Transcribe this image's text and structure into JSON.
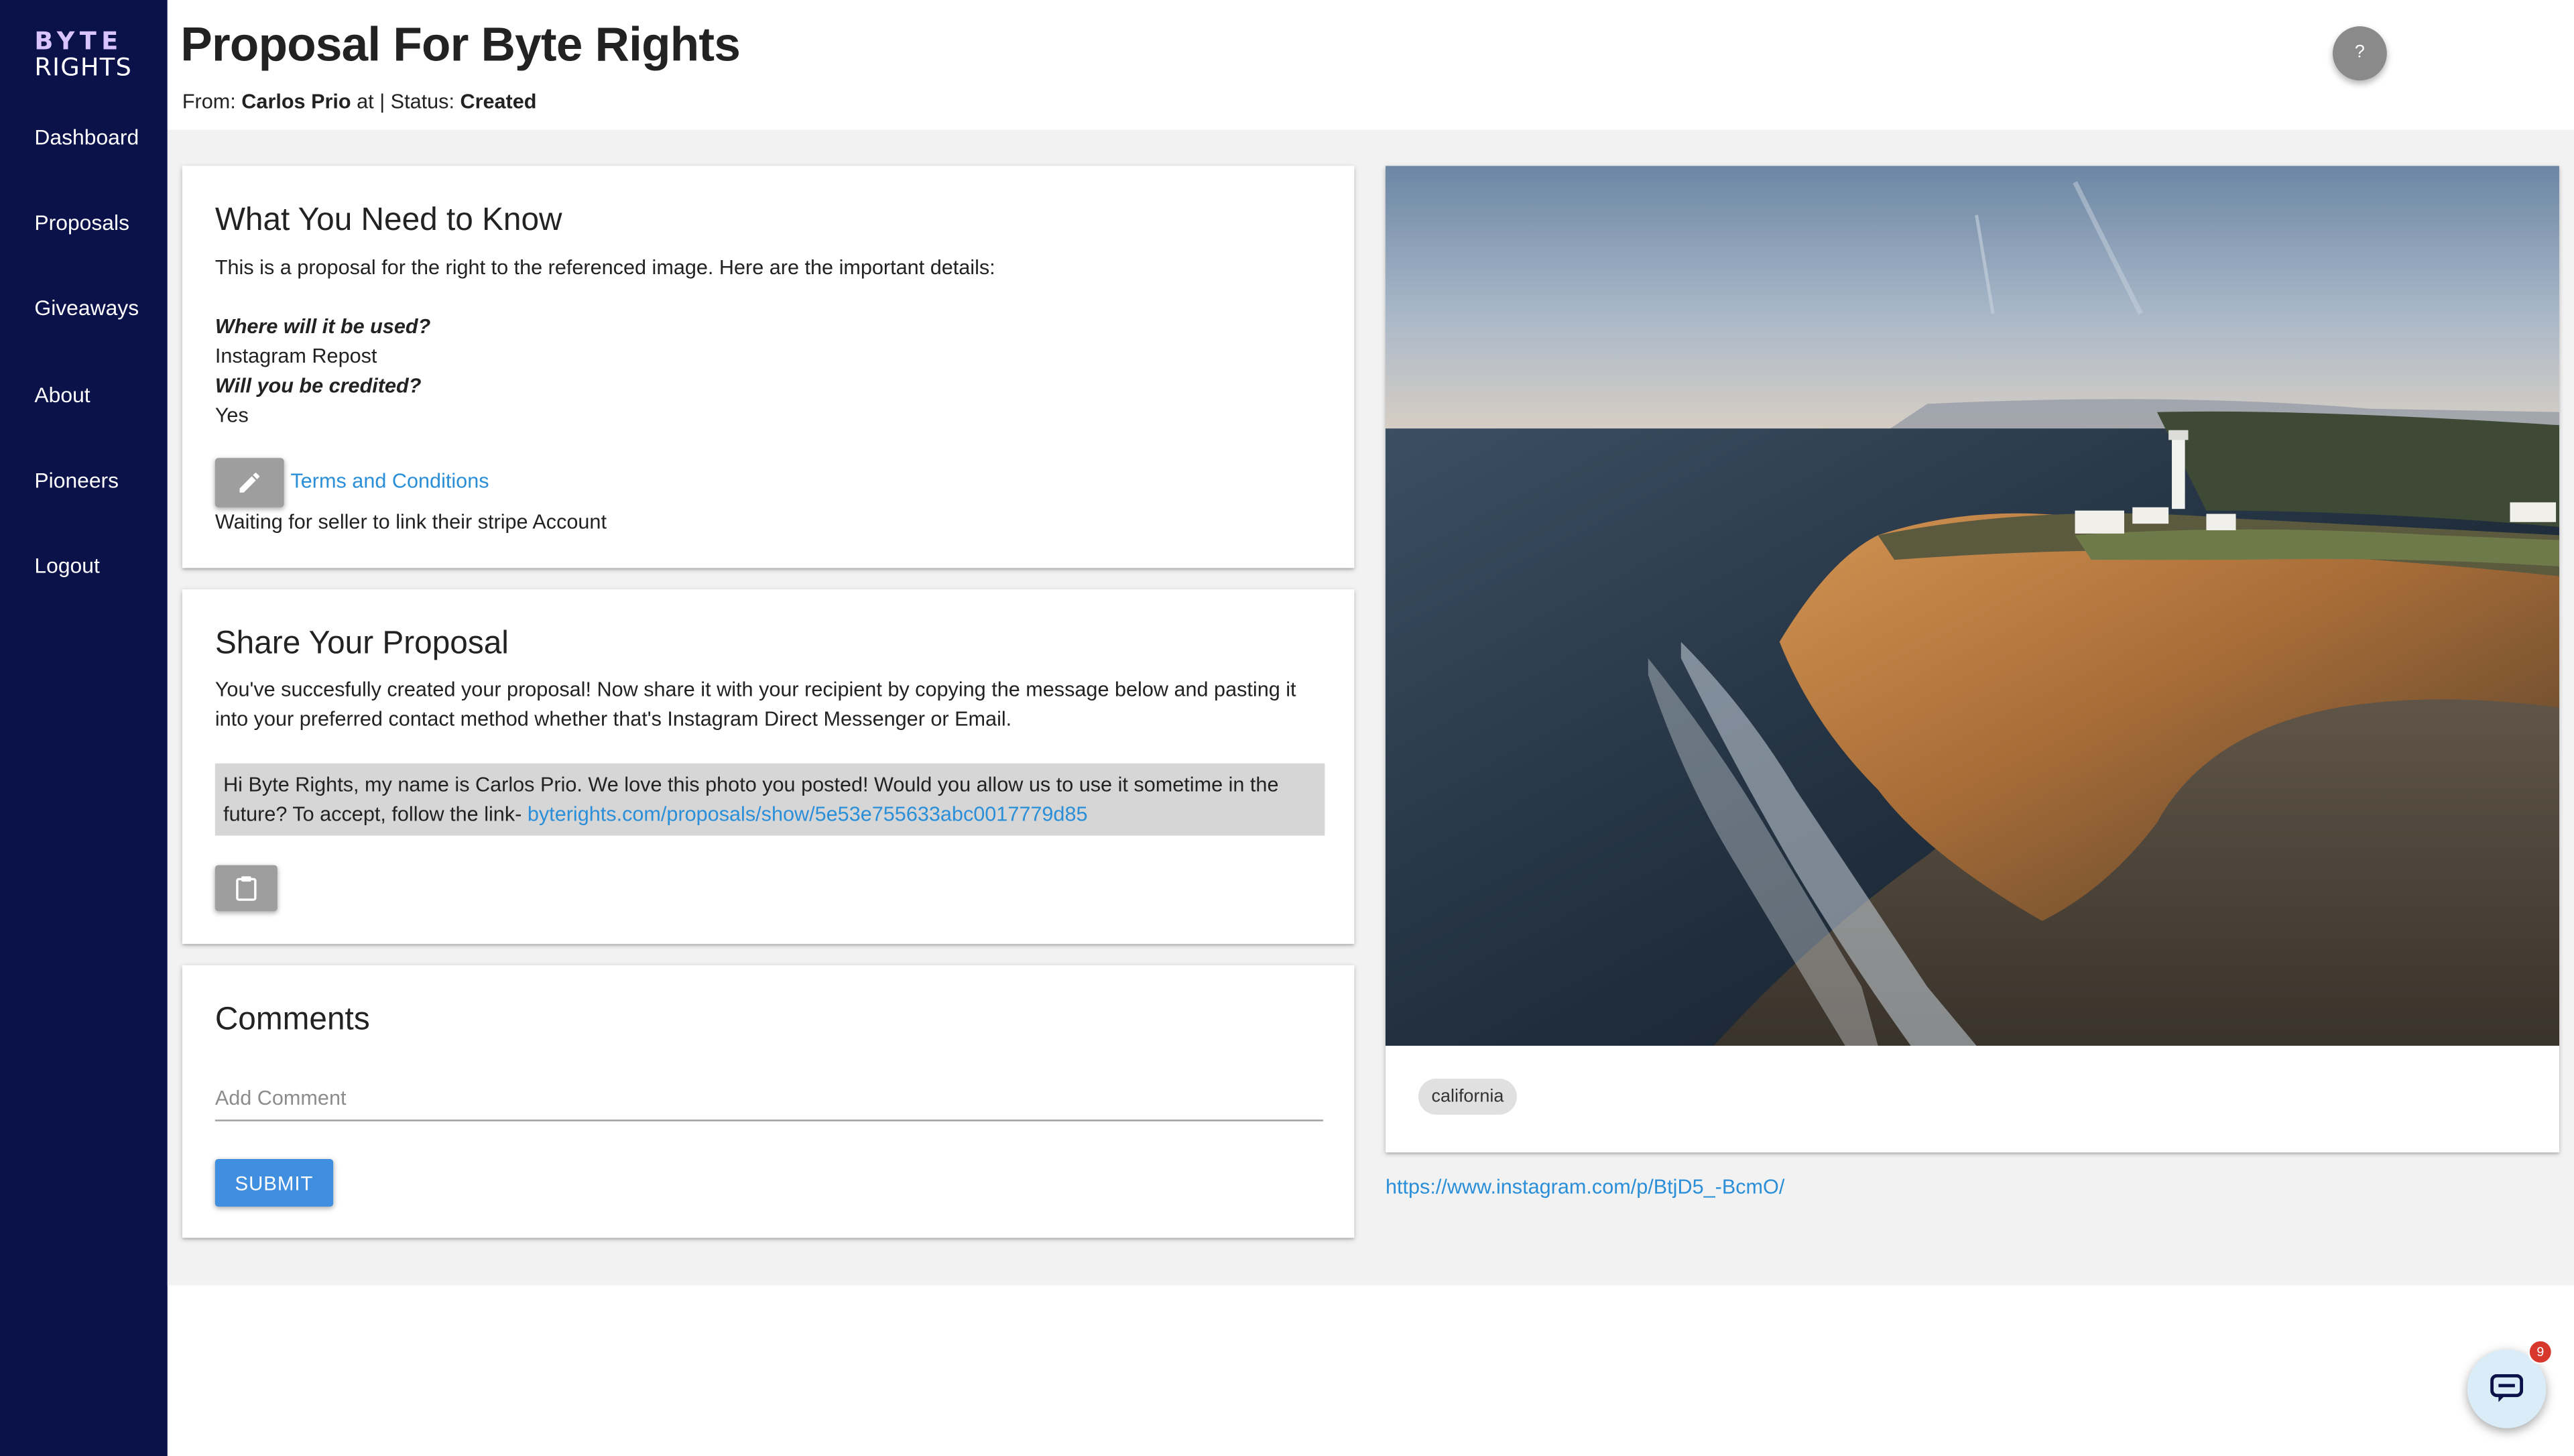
{
  "brand": {
    "logo_top": "BYTE",
    "logo_bottom": "RIGHTS"
  },
  "sidebar": {
    "items": [
      {
        "label": "Dashboard"
      },
      {
        "label": "Proposals"
      },
      {
        "label": "Giveaways"
      },
      {
        "label": "About"
      },
      {
        "label": "Pioneers"
      },
      {
        "label": "Logout"
      }
    ]
  },
  "header": {
    "title": "Proposal For Byte Rights",
    "from_prefix": "From:",
    "from_name": "Carlos Prio",
    "at_text": "at | Status:",
    "status": "Created",
    "help_label": "?"
  },
  "know_card": {
    "title": "What You Need to Know",
    "intro": "This is a proposal for the right to the referenced image. Here are the important details:",
    "q1": "Where will it be used?",
    "a1": "Instagram Repost",
    "q2": "Will you be credited?",
    "a2": "Yes",
    "terms_link": "Terms and Conditions",
    "waiting_text": "Waiting for seller to link their stripe Account"
  },
  "share_card": {
    "title": "Share Your Proposal",
    "desc": "You've succesfully created your proposal! Now share it with your recipient by copying the message below and pasting it into your preferred contact method whether that's Instagram Direct Messenger or Email.",
    "message": "Hi Byte Rights, my name is Carlos Prio. We love this photo you posted! Would you allow us to use it sometime in the future? To accept, follow the link- ",
    "message_link": "byterights.com/proposals/show/5e53e755633abc0017779d85"
  },
  "comments_card": {
    "title": "Comments",
    "placeholder": "Add Comment",
    "value": "",
    "submit_label": "SUBMIT"
  },
  "image_card": {
    "tag": "california",
    "source_link": "https://www.instagram.com/p/BtjD5_-BcmO/"
  },
  "chat": {
    "badge_count": "9"
  },
  "colors": {
    "sidebar_bg": "#0b1149",
    "accent": "#3f8ee0",
    "link": "#2a8fd8",
    "badge": "#d8382b"
  },
  "icons": [
    "pencil-icon",
    "clipboard-icon",
    "chat-icon",
    "help-icon"
  ]
}
